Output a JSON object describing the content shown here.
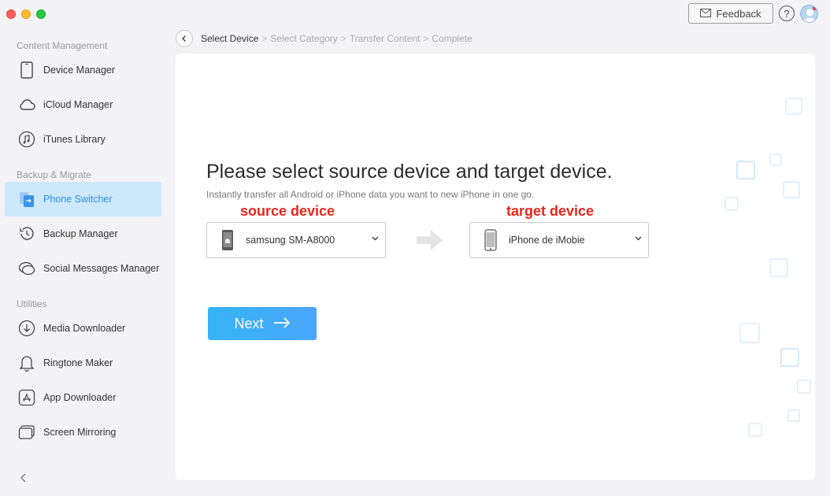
{
  "sidebar": {
    "sections": [
      {
        "title": "Content Management"
      },
      {
        "title": "Backup & Migrate"
      },
      {
        "title": "Utilities"
      }
    ],
    "items": [
      {
        "label": "Device Manager",
        "icon": "phone-icon"
      },
      {
        "label": "iCloud Manager",
        "icon": "cloud-icon"
      },
      {
        "label": "iTunes Library",
        "icon": "music-note-icon"
      },
      {
        "label": "Phone Switcher",
        "icon": "phone-switch-icon",
        "active": true
      },
      {
        "label": "Backup Manager",
        "icon": "clock-backup-icon"
      },
      {
        "label": "Social Messages Manager",
        "icon": "chat-bubbles-icon"
      },
      {
        "label": "Media Downloader",
        "icon": "download-icon"
      },
      {
        "label": "Ringtone Maker",
        "icon": "bell-icon"
      },
      {
        "label": "App Downloader",
        "icon": "app-store-icon"
      },
      {
        "label": "Screen Mirroring",
        "icon": "screen-mirror-icon"
      }
    ]
  },
  "header": {
    "feedback_label": "Feedback",
    "help_label": "?"
  },
  "breadcrumb": {
    "steps": [
      "Select Device",
      "Select Category",
      "Transfer Content",
      "Complete"
    ],
    "separator": ">"
  },
  "main": {
    "title": "Please select source device and target device.",
    "subtitle": "Instantly transfer all Android or iPhone data you want to new iPhone in one go.",
    "source_annotation": "source device",
    "target_annotation": "target device",
    "source_device": "samsung SM-A8000",
    "target_device": "iPhone de iMobie",
    "next_label": "Next"
  },
  "colors": {
    "accent": "#36b4f7",
    "active_bg": "#cde8fb",
    "annotation": "#e8261b"
  }
}
